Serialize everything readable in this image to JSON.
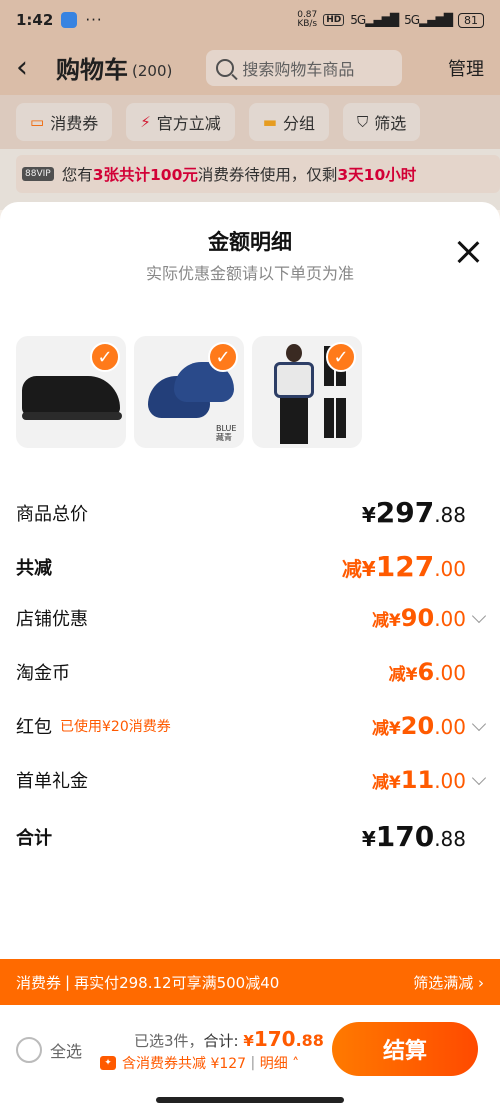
{
  "status": {
    "time": "1:42",
    "dots": "···",
    "speed": "0.87\nKB/s",
    "hd": "HD",
    "signal1": "5G",
    "signal2": "5G",
    "battery": "81"
  },
  "header": {
    "title": "购物车",
    "count": "(200)",
    "search_placeholder": "搜索购物车商品",
    "manage": "管理"
  },
  "filters": [
    {
      "icon": "coupon-icon",
      "glyph": "▭",
      "label": "消费券"
    },
    {
      "icon": "lightning-icon",
      "glyph": "⚡",
      "label": "官方立减"
    },
    {
      "icon": "folder-icon",
      "glyph": "▬",
      "label": "分组"
    },
    {
      "icon": "funnel-icon",
      "glyph": "⛉",
      "label": "筛选"
    }
  ],
  "notice": {
    "badge": "88VIP",
    "p1": "您有",
    "highlight1": "3张共计100元",
    "p2": "消费券待使用，仅剩",
    "highlight2": "3天10小时"
  },
  "sheet": {
    "title": "金额明细",
    "subtitle": "实际优惠金额请以下单页为准",
    "thumbs": [
      {
        "name": "black-sneaker",
        "check": "✓"
      },
      {
        "name": "blue-slippers",
        "label": "BLUE\n藏青",
        "check": "✓"
      },
      {
        "name": "tracksuit",
        "check": "✓"
      }
    ],
    "rows": [
      {
        "label": "商品总价",
        "prefix": "¥",
        "int": "297",
        "dec": ".88"
      },
      {
        "label": "共减",
        "prefix": "减¥",
        "int": "127",
        "dec": ".00"
      },
      {
        "label": "店铺优惠",
        "prefix": "减¥",
        "int": "90",
        "dec": ".00"
      },
      {
        "label": "淘金币",
        "prefix": "减¥",
        "int": "6",
        "dec": ".00"
      },
      {
        "label": "红包",
        "hint": "已使用¥20消费券",
        "prefix": "减¥",
        "int": "20",
        "dec": ".00"
      },
      {
        "label": "首单礼金",
        "prefix": "减¥",
        "int": "11",
        "dec": ".00"
      },
      {
        "label": "合计",
        "prefix": "¥",
        "int": "170",
        "dec": ".88"
      }
    ]
  },
  "banner": {
    "tag": "消费券",
    "sep": "|",
    "text": "再实付298.12可享满500减40",
    "right": "筛选满减 ›"
  },
  "bottom": {
    "select_all": "全选",
    "selected": "已选3件，",
    "total_label": "合计: ",
    "total_prefix": "¥",
    "total_int": "170",
    "total_dec": ".88",
    "sub_text": "含消费券共减 ¥127",
    "sub_sep": " | ",
    "detail": "明细 ˄",
    "checkout": "结算"
  }
}
